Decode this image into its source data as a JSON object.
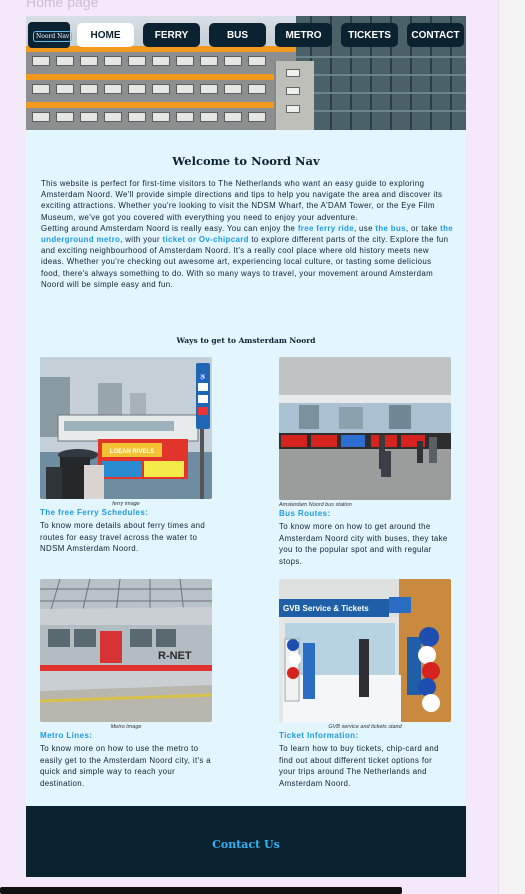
{
  "page": {
    "title": "Home page"
  },
  "nav": {
    "logo_text": "Noord Nav",
    "items": [
      {
        "label": "HOME",
        "active": true
      },
      {
        "label": "FERRY"
      },
      {
        "label": "BUS"
      },
      {
        "label": "METRO"
      },
      {
        "label": "TICKETS"
      },
      {
        "label": "CONTACT"
      }
    ]
  },
  "main": {
    "heading": "Welcome to Noord Nav",
    "intro_p1": "This website is perfect for first-time visitors to The Netherlands who want an easy guide to exploring Amsterdam Noord. We'll provide simple directions and tips to help you navigate the area and discover its exciting attractions. Whether you're looking to visit the NDSM Wharf, the A'DAM Tower, or the Eye Film Museum, we've got you covered with everything you need to enjoy your adventure.",
    "intro_p2_a": "Getting around Amsterdam Noord is really easy. You can enjoy the ",
    "link_ferry": "free ferry ride",
    "intro_p2_b": ", use ",
    "link_bus": "the bus",
    "intro_p2_c": ", or take ",
    "link_underground": "the underground metro",
    "intro_p2_d": ", with your ",
    "link_ticket": "ticket or Ov-chipcard",
    "intro_p2_e": " to explore different parts of the city. Explore the fun and exciting neighbourhood of Amsterdam Noord. It's a really cool place where old history meets new ideas. Whether you're checking out awesome art, experiencing local culture, or tasting some delicious food, there's always something to do. With so many ways to travel, your movement around Amsterdam Noord will be simple easy  and fun.",
    "ways_heading": "Ways to get to Amsterdam Noord"
  },
  "cards": [
    {
      "caption": "ferry image",
      "title": "The free Ferry Schedules:",
      "text": "To know more details about ferry times and routes for easy travel across the water to NDSM Amsterdam Noord."
    },
    {
      "caption": "Amsterdam Noord bus station",
      "title": "Bus Routes:",
      "text": "To know more on how to get around the Amsterdam Noord city with buses, they take you to the popular spot and with regular stops."
    },
    {
      "caption": "Metro Image",
      "title": "Metro Lines:",
      "text": "To know more on how to use the metro to easily get to the Amsterdam Noord city, it's a quick and simple way to reach your destination."
    },
    {
      "caption": "GVB service and tickets stand",
      "title": "Ticket Information:",
      "text": "To learn how to buy tickets, chip-card and find out about different ticket options  for your trips around The Netherlands and Amsterdam Noord."
    }
  ],
  "photo_text": {
    "ferry_sign": "LOEAN RIVELS",
    "metro_logo": "R-NET",
    "gvb_sign": "GVB Service & Tickets"
  },
  "footer": {
    "heading": "Contact Us"
  },
  "colors": {
    "navy": "#0b2230",
    "accent": "#1e9be0",
    "background": "#e3f5ff",
    "footer_heading": "#34b3f5"
  }
}
